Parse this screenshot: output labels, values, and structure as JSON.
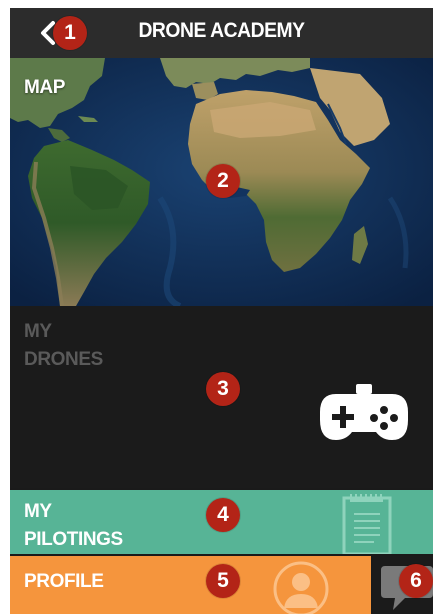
{
  "header": {
    "title": "DRONE ACADEMY",
    "back_icon": "chevron-left-icon"
  },
  "tiles": {
    "map": {
      "label": "MAP"
    },
    "drones": {
      "label_line1": "MY",
      "label_line2": "DRONES",
      "icon": "gamepad-icon"
    },
    "pilotings": {
      "label_line1": "MY",
      "label_line2": "PILOTINGS",
      "icon": "notepad-icon"
    },
    "profile": {
      "label": "PROFILE",
      "icon": "user-avatar-icon"
    },
    "chat": {
      "icon": "chat-bubble-icon"
    }
  },
  "markers": [
    "1",
    "2",
    "3",
    "4",
    "5",
    "6"
  ],
  "colors": {
    "header_bg": "#2c2c2c",
    "map_ocean": "#0f2c54",
    "drones_bg": "#1b1b1b",
    "drones_text": "#5a5a5a",
    "pilotings_bg": "#57b496",
    "profile_bg": "#f5953d",
    "chat_bg": "#1b1b1b",
    "marker_bg": "#b32417"
  }
}
